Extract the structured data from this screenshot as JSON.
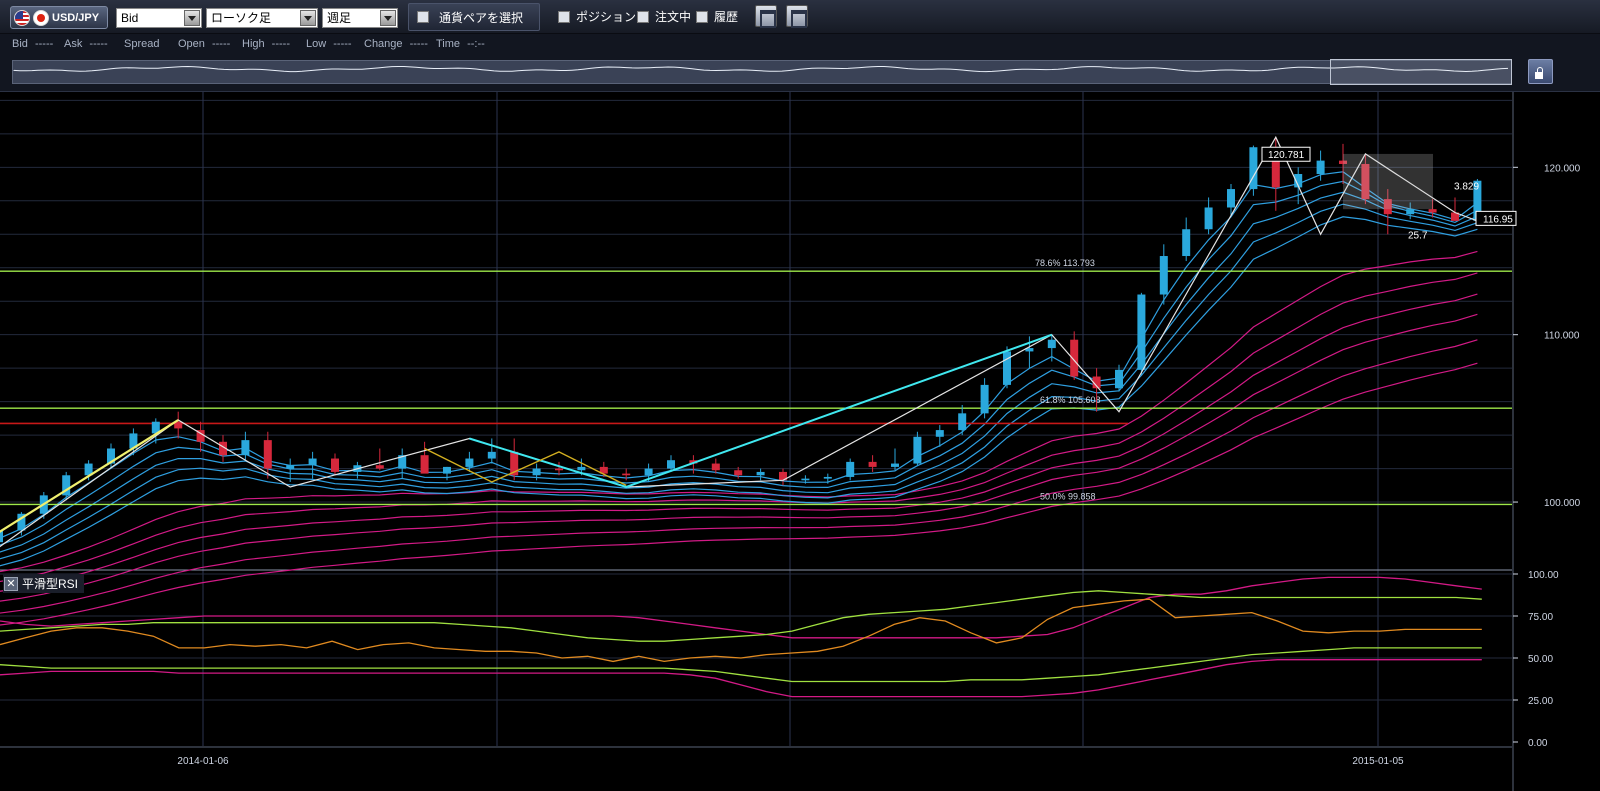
{
  "toolbar": {
    "symbol": "USD/JPY",
    "price_type": "Bid",
    "chart_type": "ローソク足",
    "timeframe": "週足",
    "pair_select": "通貨ペアを選択",
    "position": "ポジション",
    "orders": "注文中",
    "history": "履歴"
  },
  "infobar": [
    {
      "label": "Bid",
      "value": "-----"
    },
    {
      "label": "Ask",
      "value": "-----"
    },
    {
      "label": "Spread",
      "value": ""
    },
    {
      "label": "Open",
      "value": "-----"
    },
    {
      "label": "High",
      "value": "-----"
    },
    {
      "label": "Low",
      "value": "-----"
    },
    {
      "label": "Change",
      "value": "-----"
    },
    {
      "label": "Time",
      "value": "--:--"
    }
  ],
  "rsi_panel": {
    "title": "平滑型RSI"
  },
  "colors": {
    "bull": "#2aa8dc",
    "bear": "#d6283c",
    "ma_fast": "#2f9fe0",
    "ma_slow": "#d21a86",
    "fib": "#9ee84a",
    "support": "#c81818",
    "zigzag": "#e4e4e4",
    "wave": "#40e8f0"
  },
  "chart_data": {
    "type": "candlestick",
    "x_ticks": [
      "2014-01-06",
      "2015-01-05"
    ],
    "price_ticks": [
      100.0,
      110.0,
      120.0
    ],
    "rsi_ticks": [
      0.0,
      25.0,
      50.0,
      75.0,
      100.0
    ],
    "ylim": [
      96.0,
      124.5
    ],
    "rsi_lim": [
      0,
      100
    ],
    "candles": [
      [
        97.6,
        98.6,
        97.2,
        98.3
      ],
      [
        98.3,
        99.4,
        98.0,
        99.3
      ],
      [
        99.3,
        100.6,
        99.0,
        100.4
      ],
      [
        100.4,
        101.8,
        100.1,
        101.6
      ],
      [
        101.6,
        102.5,
        101.3,
        102.3
      ],
      [
        102.3,
        103.5,
        102.0,
        103.2
      ],
      [
        103.2,
        104.4,
        102.8,
        104.1
      ],
      [
        104.1,
        105.0,
        103.5,
        104.8
      ],
      [
        104.8,
        105.4,
        103.8,
        104.4
      ],
      [
        104.3,
        104.8,
        103.0,
        103.6
      ],
      [
        103.6,
        104.0,
        102.4,
        102.8
      ],
      [
        102.8,
        104.2,
        102.5,
        103.7
      ],
      [
        103.7,
        104.2,
        101.4,
        102.0
      ],
      [
        102.0,
        102.6,
        101.2,
        102.2
      ],
      [
        102.2,
        103.0,
        101.4,
        102.6
      ],
      [
        102.6,
        102.9,
        101.6,
        101.8
      ],
      [
        101.8,
        102.4,
        101.4,
        102.2
      ],
      [
        102.2,
        103.2,
        101.9,
        102.0
      ],
      [
        102.0,
        103.2,
        101.4,
        102.8
      ],
      [
        102.8,
        103.6,
        102.2,
        101.7
      ],
      [
        101.7,
        102.1,
        101.3,
        102.1
      ],
      [
        102.1,
        103.0,
        101.8,
        102.6
      ],
      [
        102.6,
        103.8,
        102.3,
        103.0
      ],
      [
        103.0,
        103.8,
        101.3,
        101.6
      ],
      [
        101.6,
        102.3,
        101.3,
        102.0
      ],
      [
        102.0,
        102.4,
        101.6,
        101.9
      ],
      [
        101.9,
        102.6,
        101.6,
        102.1
      ],
      [
        102.1,
        102.4,
        101.5,
        101.7
      ],
      [
        101.7,
        102.0,
        101.3,
        101.6
      ],
      [
        101.6,
        102.3,
        101.2,
        102.0
      ],
      [
        102.0,
        102.8,
        101.8,
        102.5
      ],
      [
        102.5,
        102.8,
        101.7,
        102.3
      ],
      [
        102.3,
        102.6,
        101.7,
        101.9
      ],
      [
        101.9,
        102.1,
        101.4,
        101.6
      ],
      [
        101.6,
        102.0,
        101.3,
        101.8
      ],
      [
        101.8,
        102.0,
        101.0,
        101.3
      ],
      [
        101.3,
        101.6,
        101.1,
        101.4
      ],
      [
        101.4,
        101.7,
        101.1,
        101.5
      ],
      [
        101.5,
        102.6,
        101.3,
        102.4
      ],
      [
        102.4,
        102.8,
        101.8,
        102.1
      ],
      [
        102.1,
        103.2,
        101.9,
        102.3
      ],
      [
        102.3,
        104.2,
        102.2,
        103.9
      ],
      [
        103.9,
        104.6,
        103.3,
        104.3
      ],
      [
        104.3,
        105.8,
        104.0,
        105.3
      ],
      [
        105.3,
        107.4,
        105.0,
        107.0
      ],
      [
        107.0,
        109.3,
        106.8,
        109.0
      ],
      [
        109.0,
        109.9,
        108.0,
        109.2
      ],
      [
        109.2,
        110.0,
        108.4,
        109.7
      ],
      [
        109.7,
        110.2,
        107.3,
        107.5
      ],
      [
        107.5,
        108.0,
        105.4,
        106.8
      ],
      [
        106.8,
        108.2,
        106.6,
        107.9
      ],
      [
        107.9,
        112.5,
        107.6,
        112.4
      ],
      [
        112.4,
        115.4,
        111.8,
        114.7
      ],
      [
        114.7,
        117.0,
        114.4,
        116.3
      ],
      [
        116.3,
        118.2,
        116.0,
        117.6
      ],
      [
        117.6,
        119.0,
        117.1,
        118.7
      ],
      [
        118.7,
        121.3,
        118.3,
        121.2
      ],
      [
        121.2,
        121.8,
        117.4,
        118.8
      ],
      [
        118.8,
        120.0,
        117.8,
        119.6
      ],
      [
        119.6,
        121.0,
        119.2,
        120.4
      ],
      [
        120.4,
        121.4,
        119.0,
        120.2
      ],
      [
        120.2,
        120.8,
        117.8,
        118.1
      ],
      [
        118.1,
        118.7,
        116.0,
        117.2
      ],
      [
        117.2,
        117.9,
        116.9,
        117.5
      ],
      [
        117.5,
        118.1,
        117.0,
        117.3
      ],
      [
        117.3,
        118.2,
        116.8,
        116.8
      ],
      [
        116.8,
        119.3,
        116.7,
        119.2
      ]
    ],
    "fib_levels": [
      {
        "label": "78.6%",
        "value": "113.793",
        "price": 113.793
      },
      {
        "label": "61.8%",
        "value": "105.608",
        "price": 105.608
      },
      {
        "label": "50.0%",
        "value": "99.858",
        "price": 99.858
      }
    ],
    "support_level": 104.7,
    "annotations": [
      {
        "text": "120.781",
        "price": 120.781
      },
      {
        "text": "116.95",
        "price": 116.95
      },
      {
        "text": "3.829",
        "price": 118.9
      },
      {
        "text": "25.7",
        "price": 116.0
      }
    ],
    "rsi_series": [
      {
        "color": "#d21a86",
        "values": [
          72,
          70,
          69,
          70,
          71,
          72,
          73,
          74,
          75,
          75,
          75,
          75,
          75,
          75,
          75,
          75,
          75,
          75,
          75,
          75,
          75,
          75,
          75,
          75,
          75,
          74,
          72,
          70,
          68,
          66,
          64,
          62,
          62,
          62,
          62,
          62,
          62,
          62,
          62,
          62,
          63,
          64,
          68,
          74,
          80,
          86,
          88,
          88,
          90,
          93,
          95,
          97,
          98,
          98,
          98,
          97,
          95,
          93,
          91
        ]
      },
      {
        "color": "#a0e040",
        "values": [
          66,
          67,
          68,
          69,
          70,
          70,
          71,
          71,
          71,
          71,
          71,
          71,
          71,
          71,
          71,
          71,
          71,
          71,
          70,
          69,
          68,
          66,
          64,
          62,
          61,
          60,
          60,
          61,
          62,
          63,
          64,
          66,
          70,
          74,
          76,
          77,
          78,
          79,
          81,
          83,
          85,
          87,
          89,
          90,
          89,
          88,
          87,
          86,
          86,
          86,
          86,
          86,
          86,
          86,
          86,
          86,
          86,
          86,
          85
        ]
      },
      {
        "color": "#e08a20",
        "values": [
          58,
          62,
          66,
          68,
          68,
          66,
          63,
          56,
          56,
          58,
          57,
          58,
          56,
          60,
          55,
          58,
          59,
          56,
          55,
          54,
          54,
          53,
          50,
          51,
          48,
          51,
          48,
          50,
          51,
          50,
          52,
          53,
          54,
          57,
          63,
          70,
          74,
          72,
          65,
          59,
          62,
          73,
          80,
          82,
          84,
          85,
          74,
          75,
          76,
          77,
          72,
          66,
          65,
          66,
          66,
          67,
          67,
          67,
          67
        ]
      },
      {
        "color": "#a0e040",
        "values": [
          46,
          45,
          44,
          44,
          44,
          44,
          44,
          44,
          44,
          44,
          44,
          44,
          44,
          44,
          44,
          44,
          44,
          44,
          44,
          44,
          44,
          44,
          44,
          44,
          44,
          44,
          44,
          43,
          42,
          40,
          38,
          36,
          36,
          36,
          36,
          36,
          36,
          36,
          37,
          37,
          37,
          38,
          39,
          40,
          42,
          44,
          46,
          48,
          50,
          52,
          53,
          54,
          55,
          56,
          56,
          56,
          56,
          56,
          56
        ]
      },
      {
        "color": "#d21a86",
        "values": [
          40,
          41,
          42,
          42,
          42,
          42,
          42,
          41,
          41,
          41,
          41,
          41,
          41,
          41,
          41,
          41,
          41,
          41,
          41,
          41,
          41,
          41,
          41,
          41,
          41,
          41,
          41,
          40,
          38,
          34,
          30,
          27,
          27,
          27,
          27,
          27,
          27,
          27,
          27,
          27,
          27,
          28,
          29,
          31,
          34,
          37,
          40,
          43,
          46,
          48,
          49,
          49,
          49,
          49,
          49,
          49,
          49,
          49,
          49
        ]
      }
    ]
  }
}
